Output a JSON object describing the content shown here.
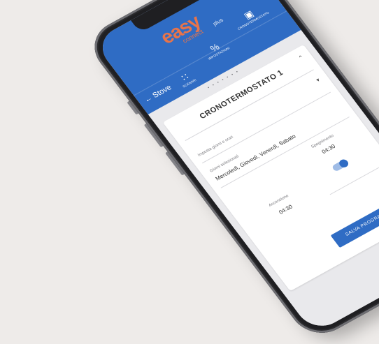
{
  "app": {
    "logo_main": "easy",
    "logo_sub": "connect",
    "logo_plus": "plus"
  },
  "nav": {
    "back_label": "Stove",
    "items": [
      {
        "label": "SCENARI",
        "icon": "grid-icon"
      },
      {
        "label": "IMPOSTAZIONI",
        "icon": "percent-icon"
      },
      {
        "label": "CRONOTERMOSTATO",
        "icon": "calendar-icon"
      }
    ]
  },
  "carousel": {
    "dots": "• • • • • • •"
  },
  "card": {
    "title": "CRONOTERMOSTATO 1",
    "dropdown_label": "Imposta giorni e orari",
    "days_label": "Giorni selezionati",
    "days_value": "Mercoledì, Giovedì, Venerdì, Sabato",
    "start_label": "Accensione",
    "start_value": "04:30",
    "end_label": "Spegnimento",
    "end_value": "04:30",
    "save_label": "SALVA PROGRAMMA"
  },
  "colors": {
    "primary": "#2f6cc4",
    "logo": "#e8744a",
    "background": "#eeebe9"
  }
}
